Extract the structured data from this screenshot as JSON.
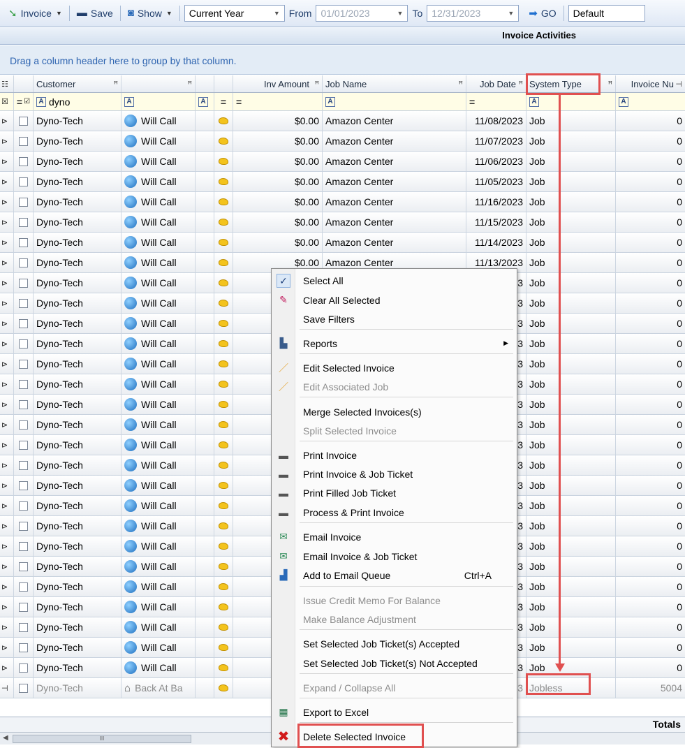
{
  "toolbar": {
    "invoice_label": "Invoice",
    "save_label": "Save",
    "show_label": "Show",
    "period_value": "Current Year",
    "from_label": "From",
    "from_date": "01/01/2023",
    "to_label": "To",
    "to_date": "12/31/2023",
    "go_label": "GO",
    "layout_value": "Default"
  },
  "title": "Invoice Activities",
  "group_hint": "Drag a column header here to group by that column.",
  "columns": {
    "customer": "Customer",
    "inv_amount": "Inv Amount",
    "job_name": "Job Name",
    "job_date": "Job Date",
    "system_type": "System Type",
    "invoice_num": "Invoice Nu"
  },
  "filter": {
    "customer_value": "dyno"
  },
  "rows": [
    {
      "customer": "Dyno-Tech",
      "ship": "Will Call",
      "amount": "$0.00",
      "job": "Amazon Center",
      "date": "11/08/2023",
      "type": "Job",
      "num": "0"
    },
    {
      "customer": "Dyno-Tech",
      "ship": "Will Call",
      "amount": "$0.00",
      "job": "Amazon Center",
      "date": "11/07/2023",
      "type": "Job",
      "num": "0"
    },
    {
      "customer": "Dyno-Tech",
      "ship": "Will Call",
      "amount": "$0.00",
      "job": "Amazon Center",
      "date": "11/06/2023",
      "type": "Job",
      "num": "0"
    },
    {
      "customer": "Dyno-Tech",
      "ship": "Will Call",
      "amount": "$0.00",
      "job": "Amazon Center",
      "date": "11/05/2023",
      "type": "Job",
      "num": "0"
    },
    {
      "customer": "Dyno-Tech",
      "ship": "Will Call",
      "amount": "$0.00",
      "job": "Amazon Center",
      "date": "11/16/2023",
      "type": "Job",
      "num": "0"
    },
    {
      "customer": "Dyno-Tech",
      "ship": "Will Call",
      "amount": "$0.00",
      "job": "Amazon Center",
      "date": "11/15/2023",
      "type": "Job",
      "num": "0"
    },
    {
      "customer": "Dyno-Tech",
      "ship": "Will Call",
      "amount": "$0.00",
      "job": "Amazon Center",
      "date": "11/14/2023",
      "type": "Job",
      "num": "0"
    },
    {
      "customer": "Dyno-Tech",
      "ship": "Will Call",
      "amount": "$0.00",
      "job": "Amazon Center",
      "date": "11/13/2023",
      "type": "Job",
      "num": "0"
    },
    {
      "customer": "Dyno-Tech",
      "ship": "Will Call",
      "amount": "",
      "job": "",
      "date": "3",
      "type": "Job",
      "num": "0"
    },
    {
      "customer": "Dyno-Tech",
      "ship": "Will Call",
      "amount": "",
      "job": "",
      "date": "3",
      "type": "Job",
      "num": "0"
    },
    {
      "customer": "Dyno-Tech",
      "ship": "Will Call",
      "amount": "",
      "job": "",
      "date": "3",
      "type": "Job",
      "num": "0"
    },
    {
      "customer": "Dyno-Tech",
      "ship": "Will Call",
      "amount": "",
      "job": "",
      "date": "3",
      "type": "Job",
      "num": "0"
    },
    {
      "customer": "Dyno-Tech",
      "ship": "Will Call",
      "amount": "",
      "job": "",
      "date": "3",
      "type": "Job",
      "num": "0"
    },
    {
      "customer": "Dyno-Tech",
      "ship": "Will Call",
      "amount": "",
      "job": "",
      "date": "3",
      "type": "Job",
      "num": "0"
    },
    {
      "customer": "Dyno-Tech",
      "ship": "Will Call",
      "amount": "",
      "job": "",
      "date": "3",
      "type": "Job",
      "num": "0"
    },
    {
      "customer": "Dyno-Tech",
      "ship": "Will Call",
      "amount": "",
      "job": "",
      "date": "3",
      "type": "Job",
      "num": "0"
    },
    {
      "customer": "Dyno-Tech",
      "ship": "Will Call",
      "amount": "",
      "job": "",
      "date": "3",
      "type": "Job",
      "num": "0"
    },
    {
      "customer": "Dyno-Tech",
      "ship": "Will Call",
      "amount": "",
      "job": "",
      "date": "3",
      "type": "Job",
      "num": "0"
    },
    {
      "customer": "Dyno-Tech",
      "ship": "Will Call",
      "amount": "",
      "job": "",
      "date": "3",
      "type": "Job",
      "num": "0"
    },
    {
      "customer": "Dyno-Tech",
      "ship": "Will Call",
      "amount": "",
      "job": "",
      "date": "3",
      "type": "Job",
      "num": "0"
    },
    {
      "customer": "Dyno-Tech",
      "ship": "Will Call",
      "amount": "",
      "job": "",
      "date": "3",
      "type": "Job",
      "num": "0"
    },
    {
      "customer": "Dyno-Tech",
      "ship": "Will Call",
      "amount": "",
      "job": "",
      "date": "3",
      "type": "Job",
      "num": "0"
    },
    {
      "customer": "Dyno-Tech",
      "ship": "Will Call",
      "amount": "",
      "job": "",
      "date": "3",
      "type": "Job",
      "num": "0"
    },
    {
      "customer": "Dyno-Tech",
      "ship": "Will Call",
      "amount": "",
      "job": "",
      "date": "3",
      "type": "Job",
      "num": "0"
    },
    {
      "customer": "Dyno-Tech",
      "ship": "Will Call",
      "amount": "",
      "job": "",
      "date": "3",
      "type": "Job",
      "num": "0"
    },
    {
      "customer": "Dyno-Tech",
      "ship": "Will Call",
      "amount": "",
      "job": "",
      "date": "3",
      "type": "Job",
      "num": "0"
    },
    {
      "customer": "Dyno-Tech",
      "ship": "Will Call",
      "amount": "",
      "job": "",
      "date": "3",
      "type": "Job",
      "num": "0"
    },
    {
      "customer": "Dyno-Tech",
      "ship": "Will Call",
      "amount": "",
      "job": "",
      "date": "3",
      "type": "Job",
      "num": "0"
    },
    {
      "customer": "Dyno-Tech",
      "ship": "Back At Ba",
      "amount": "",
      "job": "",
      "date": "3",
      "type": "Jobless",
      "num": "5004",
      "dim": true
    }
  ],
  "totals_label": "Totals",
  "menu": {
    "items": [
      {
        "label": "Select All",
        "icon": "check-icon"
      },
      {
        "label": "Clear All Selected",
        "icon": "eraser-icon"
      },
      {
        "label": "Save Filters",
        "icon": ""
      },
      {
        "label": "Reports",
        "icon": "reports-icon",
        "submenu": true
      },
      {
        "label": "Edit Selected Invoice",
        "icon": "pencil-icon"
      },
      {
        "label": "Edit Associated Job",
        "icon": "pencil-icon",
        "disabled": true
      },
      {
        "label": "Merge Selected Invoices(s)",
        "icon": ""
      },
      {
        "label": "Split Selected Invoice",
        "icon": "",
        "disabled": true
      },
      {
        "label": "Print Invoice",
        "icon": "printer-icon"
      },
      {
        "label": "Print Invoice & Job Ticket",
        "icon": "printer-icon"
      },
      {
        "label": "Print Filled Job Ticket",
        "icon": "printer-icon"
      },
      {
        "label": "Process & Print Invoice",
        "icon": "printer-icon"
      },
      {
        "label": "Email Invoice",
        "icon": "email-icon"
      },
      {
        "label": "Email Invoice & Job Ticket",
        "icon": "email-icon"
      },
      {
        "label": "Add to Email Queue",
        "icon": "queue-icon",
        "shortcut": "Ctrl+A"
      },
      {
        "label": "Issue Credit Memo For Balance",
        "icon": "",
        "disabled": true
      },
      {
        "label": "Make Balance Adjustment",
        "icon": "",
        "disabled": true
      },
      {
        "label": "Set Selected Job Ticket(s) Accepted",
        "icon": ""
      },
      {
        "label": "Set Selected Job Ticket(s) Not Accepted",
        "icon": ""
      },
      {
        "label": "Expand / Collapse All",
        "icon": "",
        "disabled": true
      },
      {
        "label": "Export to Excel",
        "icon": "excel-icon"
      },
      {
        "label": "Delete Selected Invoice",
        "icon": "delete-x-icon"
      }
    ]
  },
  "colors": {
    "highlight": "#e05050",
    "link_blue": "#2e64b0",
    "delete_red": "#d11a1a"
  }
}
